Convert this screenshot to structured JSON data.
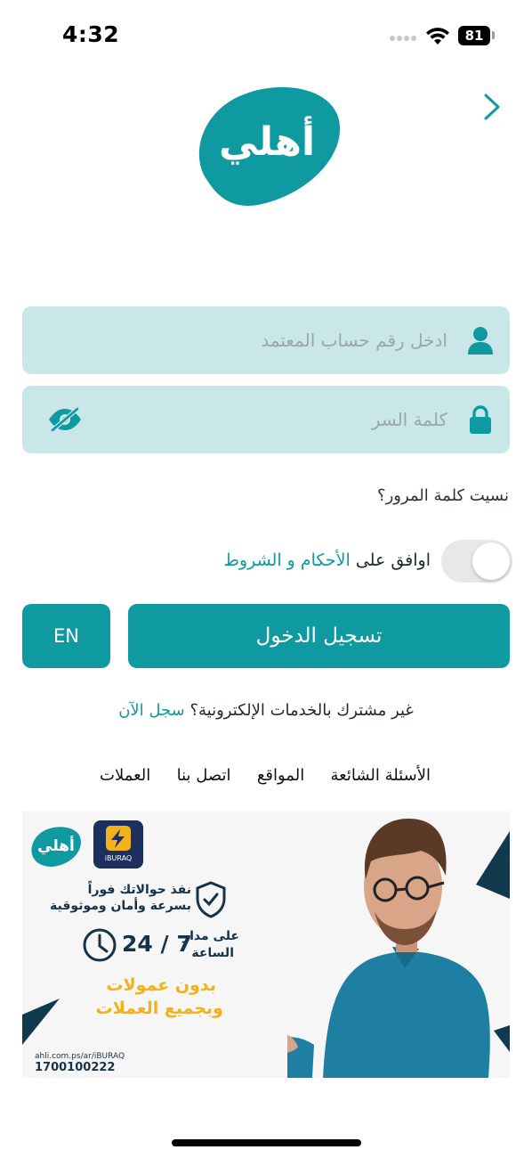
{
  "status_bar": {
    "time": "4:32",
    "battery": "81"
  },
  "colors": {
    "accent": "#0e9aa0",
    "field_background": "#c9e7e8",
    "placeholder": "#9aa7a8",
    "toggle_off": "#e8e8e8"
  },
  "header": {
    "back_icon": "chevron-right-icon",
    "logo_text": "أهلي"
  },
  "form": {
    "account_placeholder": "ادخل رقم حساب المعتمد",
    "account_value": "",
    "account_icon": "user-icon",
    "password_placeholder": "كلمة السر",
    "password_value": "",
    "password_icon": "lock-icon",
    "visibility_icon": "eye-off-icon",
    "forgot_password": "نسيت كلمة المرور؟",
    "agree_prefix": "اوافق على ",
    "agree_link": "الأحكام و الشروط",
    "terms_accepted": false
  },
  "actions": {
    "login_label": "تسجيل الدخول",
    "language_label": "EN"
  },
  "register": {
    "prompt": "غير مشترك بالخدمات الإلكترونية؟ ",
    "link": "سجل الآن"
  },
  "footer_links": [
    "الأسئلة الشائعة",
    "المواقع",
    "اتصل بنا",
    "العملات"
  ],
  "banner": {
    "logo_text": "أهلي",
    "brand": "iBURAQ",
    "line1": "نفذ حوالاتك فوراً",
    "line2": "بسرعة وأمان وموثوقية",
    "availability": "24 / 7",
    "availability_caption_1": "على مدار",
    "availability_caption_2": "الساعة",
    "promo_1": "بدون عمولات",
    "promo_2": "وبجميع العملات",
    "url": "ahli.com.ps/ar/iBURAQ",
    "phone": "1700100222"
  }
}
